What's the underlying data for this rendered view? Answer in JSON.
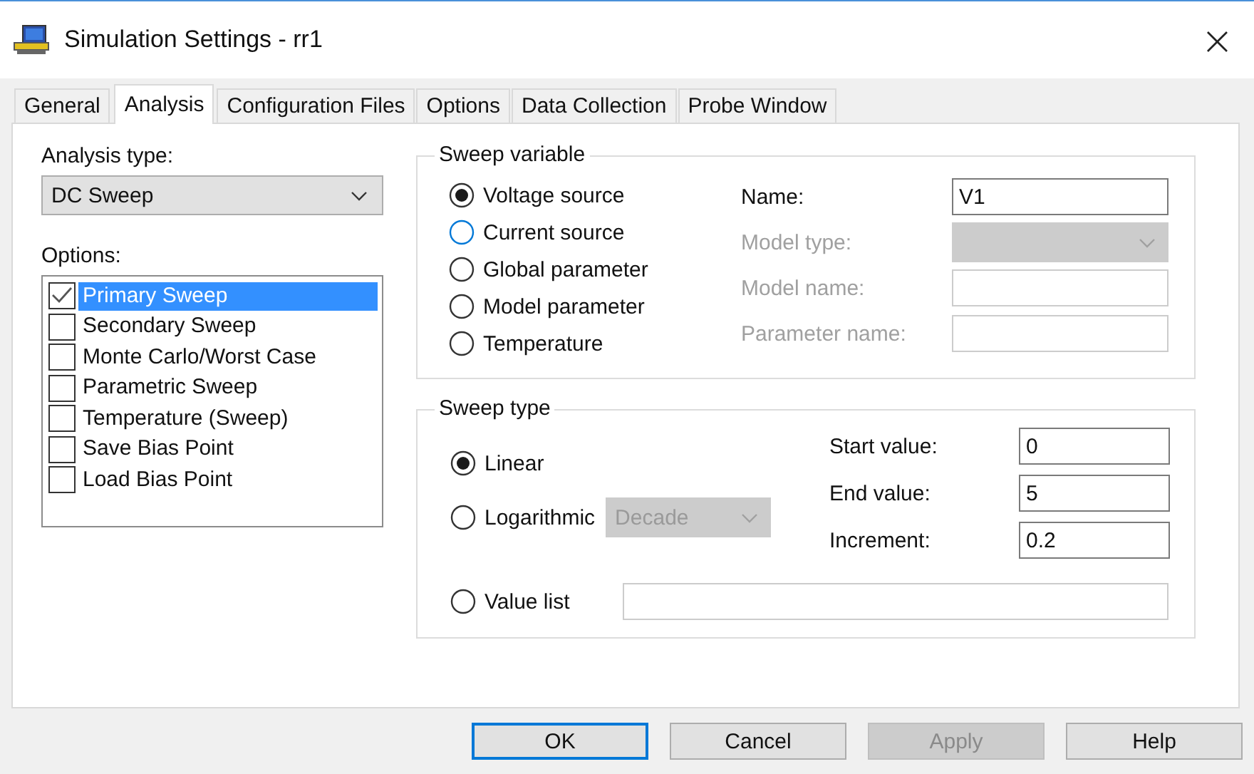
{
  "window": {
    "title": "Simulation Settings - rr1",
    "close": "×"
  },
  "tabs": [
    {
      "label": "General",
      "selected": false
    },
    {
      "label": "Analysis",
      "selected": true
    },
    {
      "label": "Configuration Files",
      "selected": false
    },
    {
      "label": "Options",
      "selected": false
    },
    {
      "label": "Data Collection",
      "selected": false
    },
    {
      "label": "Probe Window",
      "selected": false
    }
  ],
  "analysis_type": {
    "label": "Analysis type:",
    "value": "DC Sweep"
  },
  "options": {
    "label": "Options:",
    "items": [
      {
        "label": "Primary Sweep",
        "checked": true,
        "selected": true
      },
      {
        "label": "Secondary Sweep",
        "checked": false,
        "selected": false
      },
      {
        "label": "Monte Carlo/Worst Case",
        "checked": false,
        "selected": false
      },
      {
        "label": "Parametric Sweep",
        "checked": false,
        "selected": false
      },
      {
        "label": "Temperature (Sweep)",
        "checked": false,
        "selected": false
      },
      {
        "label": "Save Bias Point",
        "checked": false,
        "selected": false
      },
      {
        "label": "Load Bias Point",
        "checked": false,
        "selected": false
      }
    ]
  },
  "sweep_variable": {
    "title": "Sweep variable",
    "options": [
      {
        "label": "Voltage source",
        "selected": true,
        "focused": false
      },
      {
        "label": "Current source",
        "selected": false,
        "focused": true
      },
      {
        "label": "Global parameter",
        "selected": false,
        "focused": false
      },
      {
        "label": "Model parameter",
        "selected": false,
        "focused": false
      },
      {
        "label": "Temperature",
        "selected": false,
        "focused": false
      }
    ],
    "fields": [
      {
        "label": "Name:",
        "kind": "text",
        "value": "V1",
        "disabled": false
      },
      {
        "label": "Model type:",
        "kind": "dropdown",
        "disabled": true
      },
      {
        "label": "Model name:",
        "kind": "text",
        "disabled": true
      },
      {
        "label": "Parameter name:",
        "kind": "text",
        "disabled": true
      }
    ]
  },
  "sweep_type": {
    "title": "Sweep type",
    "options": [
      {
        "label": "Linear",
        "selected": true,
        "kind": "plain"
      },
      {
        "label": "Logarithmic",
        "selected": false,
        "kind": "dropdown",
        "dropdown": {
          "value": "Decade",
          "disabled": true
        }
      },
      {
        "label": "Value list",
        "selected": false,
        "kind": "field"
      }
    ],
    "fields": [
      {
        "label": "Start value:",
        "value": "0"
      },
      {
        "label": "End value:",
        "value": "5"
      },
      {
        "label": "Increment:",
        "value": "0.2"
      }
    ]
  },
  "buttons": [
    {
      "label": "OK",
      "default": true,
      "disabled": false
    },
    {
      "label": "Cancel",
      "default": false,
      "disabled": false
    },
    {
      "label": "Apply",
      "default": false,
      "disabled": true
    },
    {
      "label": "Help",
      "default": false,
      "disabled": false
    }
  ]
}
